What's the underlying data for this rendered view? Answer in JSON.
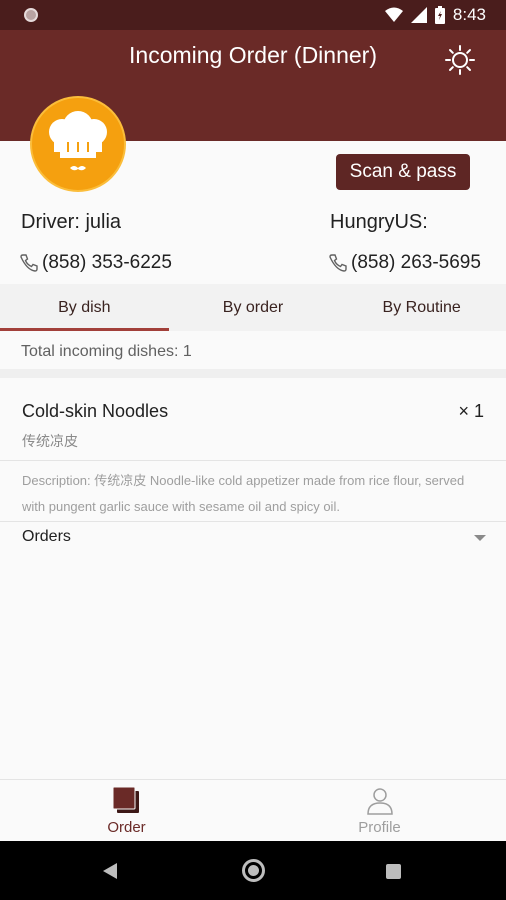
{
  "status_bar": {
    "time": "8:43",
    "icons": [
      "notification-dot-icon",
      "wifi-icon",
      "signal-icon",
      "battery-icon"
    ]
  },
  "app_bar": {
    "title": "Incoming Order (Dinner)",
    "right_icon": "brightness-icon"
  },
  "header": {
    "avatar_icon": "chef-hat-icon",
    "scan_button_label": "Scan & pass",
    "driver_label": "Driver: julia",
    "driver_phone": "(858) 353-6225",
    "restaurant_label": "HungryUS:",
    "restaurant_phone": "(858) 263-5695"
  },
  "tabs": [
    {
      "label": "By dish",
      "active": true
    },
    {
      "label": "By order",
      "active": false
    },
    {
      "label": "By Routine",
      "active": false
    }
  ],
  "summary": {
    "total_text": "Total incoming dishes: 1"
  },
  "dish": {
    "name": "Cold-skin Noodles",
    "subtitle": "传统凉皮",
    "quantity": "× 1",
    "description": "Description: 传统凉皮 Noodle-like cold appetizer made from rice flour, served with pungent garlic sauce with sesame oil and spicy oil.",
    "orders_label": "Orders"
  },
  "bottom_nav": [
    {
      "label": "Order",
      "icon": "order-icon",
      "active": true
    },
    {
      "label": "Profile",
      "icon": "profile-icon",
      "active": false
    }
  ],
  "colors": {
    "primary": "#6a2a27",
    "status_bar": "#4a1d1c",
    "accent_underline": "#a2403a",
    "avatar": "#f5a00f"
  }
}
